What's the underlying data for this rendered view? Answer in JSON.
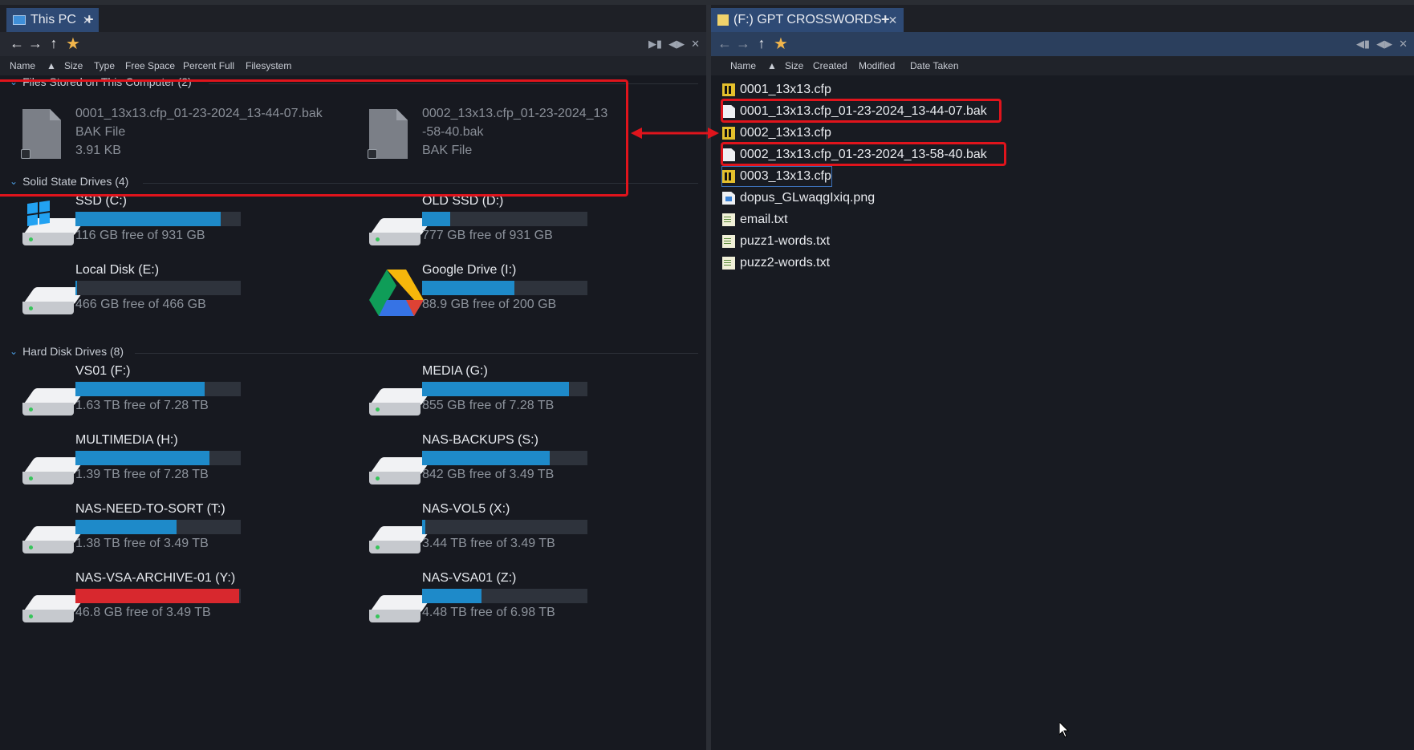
{
  "left": {
    "tab": {
      "label": "This PC",
      "close": "✕",
      "add": "+"
    },
    "columns": [
      "Name",
      "Size",
      "Type",
      "Free Space",
      "Percent Full",
      "Filesystem"
    ],
    "groups": {
      "files": "Files Stored on This Computer (2)",
      "ssd": "Solid State Drives (4)",
      "hdd": "Hard Disk Drives (8)"
    },
    "files": [
      {
        "name": "0001_13x13.cfp_01-23-2024_13-44-07.bak",
        "type": "BAK File",
        "size": "3.91 KB"
      },
      {
        "name_line1": "0002_13x13.cfp_01-23-2024_13",
        "name_line2": "-58-40.bak",
        "type": "BAK File"
      }
    ],
    "ssd_drives": [
      {
        "name": "SSD (C:)",
        "free": "116 GB free of 931 GB",
        "fill": 0.88,
        "icon": "windows-drive-icon"
      },
      {
        "name": "OLD SSD (D:)",
        "free": "777 GB free of 931 GB",
        "fill": 0.17,
        "icon": "drive-icon"
      },
      {
        "name": "Local Disk (E:)",
        "free": "466 GB free of 466 GB",
        "fill": 0.01,
        "icon": "drive-icon"
      },
      {
        "name": "Google Drive (I:)",
        "free": "88.9 GB free of 200 GB",
        "fill": 0.56,
        "icon": "google-drive-icon"
      }
    ],
    "hdd_drives": [
      {
        "name": "VS01 (F:)",
        "free": "1.63 TB free of 7.28 TB",
        "fill": 0.78
      },
      {
        "name": "MEDIA (G:)",
        "free": "855 GB free of 7.28 TB",
        "fill": 0.89
      },
      {
        "name": "MULTIMEDIA (H:)",
        "free": "1.39 TB free of 7.28 TB",
        "fill": 0.81
      },
      {
        "name": "NAS-BACKUPS (S:)",
        "free": "842 GB free of 3.49 TB",
        "fill": 0.77
      },
      {
        "name": "NAS-NEED-TO-SORT (T:)",
        "free": "1.38 TB free of 3.49 TB",
        "fill": 0.61
      },
      {
        "name": "NAS-VOL5 (X:)",
        "free": "3.44 TB free of 3.49 TB",
        "fill": 0.02
      },
      {
        "name": "NAS-VSA-ARCHIVE-01 (Y:)",
        "free": "46.8 GB free of 3.49 TB",
        "fill": 0.99,
        "critical": true
      },
      {
        "name": "NAS-VSA01 (Z:)",
        "free": "4.48 TB free of 6.98 TB",
        "fill": 0.36
      }
    ]
  },
  "right": {
    "tab": {
      "label": "(F:) GPT CROSSWORDS",
      "close": "✕",
      "add": "+"
    },
    "columns": [
      "Name",
      "Size",
      "Created",
      "Modified",
      "Date Taken"
    ],
    "files": [
      {
        "name": "0001_13x13.cfp",
        "icon": "cfp"
      },
      {
        "name": "0001_13x13.cfp_01-23-2024_13-44-07.bak",
        "icon": "doc",
        "highlight": true
      },
      {
        "name": "0002_13x13.cfp",
        "icon": "cfp"
      },
      {
        "name": "0002_13x13.cfp_01-23-2024_13-58-40.bak",
        "icon": "doc",
        "highlight": true
      },
      {
        "name": "0003_13x13.cfp",
        "icon": "cfp",
        "selected": true
      },
      {
        "name": "dopus_GLwaqgIxiq.png",
        "icon": "png"
      },
      {
        "name": "email.txt",
        "icon": "txt"
      },
      {
        "name": "puzz1-words.txt",
        "icon": "txt"
      },
      {
        "name": "puzz2-words.txt",
        "icon": "txt"
      }
    ]
  },
  "colors": {
    "accent": "#1e8ac9",
    "critical": "#d8282e",
    "annotation": "#e0141c"
  }
}
